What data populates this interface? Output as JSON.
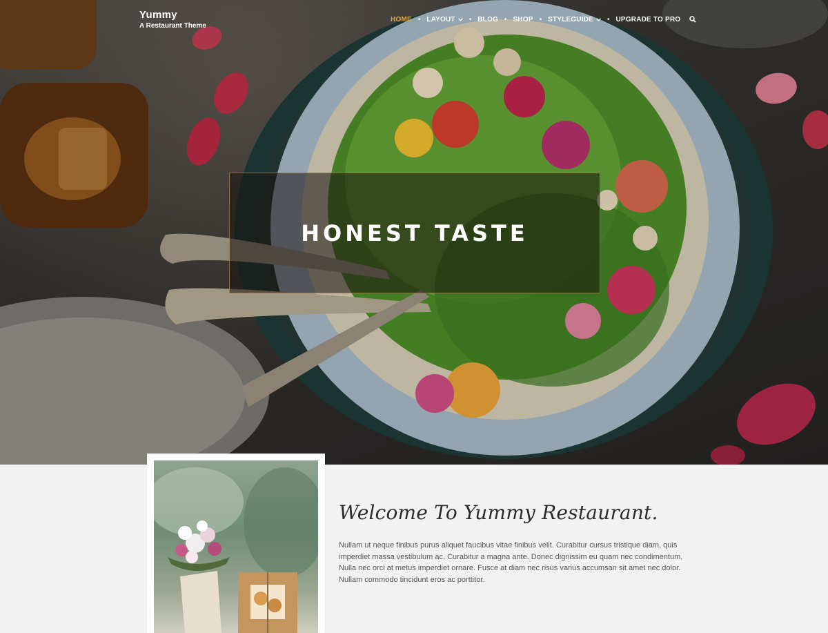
{
  "header": {
    "site_title": "Yummy",
    "tagline": "A Restaurant Theme"
  },
  "nav": {
    "items": [
      {
        "label": "HOME",
        "active": true,
        "has_dropdown": false
      },
      {
        "label": "LAYOUT",
        "active": false,
        "has_dropdown": true
      },
      {
        "label": "BLOG",
        "active": false,
        "has_dropdown": false
      },
      {
        "label": "SHOP",
        "active": false,
        "has_dropdown": false
      },
      {
        "label": "STYLEGUIDE",
        "active": false,
        "has_dropdown": true
      },
      {
        "label": "UPGRADE TO PRO",
        "active": false,
        "has_dropdown": false
      }
    ],
    "search_icon": "search-icon",
    "active_color": "#d9a64d"
  },
  "hero": {
    "caption": "HONEST TASTE"
  },
  "welcome": {
    "title": "Welcome To Yummy Restaurant.",
    "body": "Nullam ut neque finibus purus aliquet faucibus vitae finibus velit. Curabitur cursus tristique diam, quis imperdiet massa vestibulum ac. Curabitur a magna ante. Donec dignissim eu quam nec condimentum. Nulla nec orci at metus imperdiet ornare. Fusce at diam nec risus varius accumsan sit amet nec dolor. Nullam commodo tincidunt eros ac porttitor."
  }
}
